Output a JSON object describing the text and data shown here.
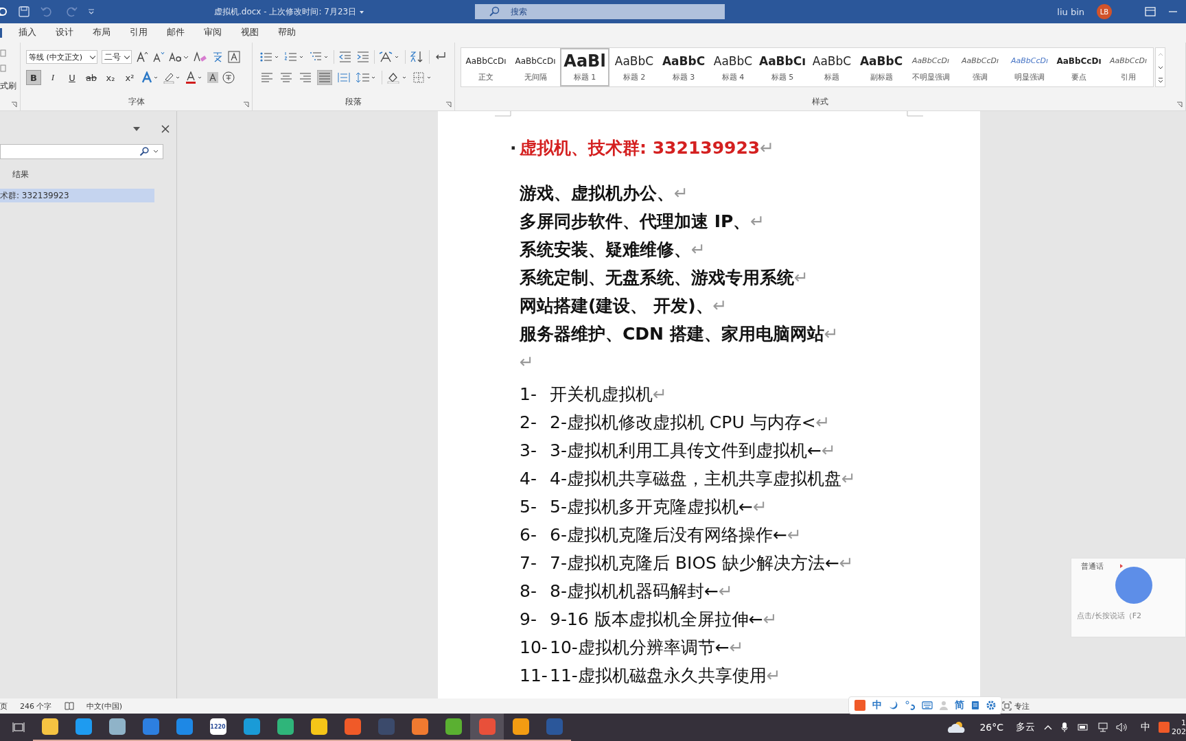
{
  "window": {
    "title": "虚拟机.docx - 上次修改时间: 7月23日",
    "search": {
      "placeholder": "搜索"
    },
    "user": {
      "name": "liu bin",
      "initials": "LB"
    }
  },
  "ribbon_tabs": [
    {
      "label": "插入",
      "selected": false
    },
    {
      "label": "设计",
      "selected": false
    },
    {
      "label": "布局",
      "selected": false
    },
    {
      "label": "引用",
      "selected": false
    },
    {
      "label": "邮件",
      "selected": false
    },
    {
      "label": "审阅",
      "selected": false
    },
    {
      "label": "视图",
      "selected": false
    },
    {
      "label": "帮助",
      "selected": false
    }
  ],
  "clipboard": {
    "label": "式刷"
  },
  "font_group": {
    "font": "等线 (中文正文)",
    "size": "二号",
    "label": "字体",
    "format_buttons": [
      {
        "label": "B",
        "kind": "bold",
        "selected": true
      },
      {
        "label": "I",
        "kind": "italic",
        "selected": false
      },
      {
        "label": "U",
        "kind": "underline",
        "selected": false
      },
      {
        "label": "ab",
        "kind": "strike",
        "selected": false
      },
      {
        "label": "x₂",
        "kind": "plain",
        "selected": false
      },
      {
        "label": "x²",
        "kind": "plain",
        "selected": false
      }
    ]
  },
  "paragraph_group": {
    "label": "段落",
    "alignments": [
      {
        "selected": false
      },
      {
        "selected": false
      },
      {
        "selected": false
      },
      {
        "selected": true
      },
      {
        "selected": false
      }
    ]
  },
  "styles_group": {
    "label": "样式",
    "styles": [
      {
        "sample": "AaBbCcDı",
        "name": "正文",
        "kind": "body",
        "selected": false
      },
      {
        "sample": "AaBbCcDı",
        "name": "无间隔",
        "kind": "body",
        "selected": false
      },
      {
        "sample": "AaBl",
        "name": "标题 1",
        "kind": "h1",
        "selected": true
      },
      {
        "sample": "AaBbC",
        "name": "标题 2",
        "kind": "h2",
        "selected": false
      },
      {
        "sample": "AaBbC",
        "name": "标题 3",
        "kind": "h3",
        "selected": false
      },
      {
        "sample": "AaBbC",
        "name": "标题 4",
        "kind": "h2",
        "selected": false
      },
      {
        "sample": "AaBbCı",
        "name": "标题 5",
        "kind": "h3",
        "selected": false
      },
      {
        "sample": "AaBbC",
        "name": "标题",
        "kind": "h2",
        "selected": false
      },
      {
        "sample": "AaBbC",
        "name": "副标题",
        "kind": "h3",
        "selected": false
      },
      {
        "sample": "AaBbCcDı",
        "name": "不明显强调",
        "kind": "italic",
        "selected": false
      },
      {
        "sample": "AaBbCcDı",
        "name": "强调",
        "kind": "italic",
        "selected": false
      },
      {
        "sample": "AaBbCcDı",
        "name": "明显强调",
        "kind": "accent",
        "selected": false
      },
      {
        "sample": "AaBbCcDı",
        "name": "要点",
        "kind": "bold",
        "selected": false
      },
      {
        "sample": "AaBbCcDı",
        "name": "引用",
        "kind": "italic",
        "selected": false
      }
    ]
  },
  "navigation_pane": {
    "tab": "结果",
    "results": [
      {
        "text": "术群: 332139923",
        "selected": true
      }
    ]
  },
  "document": {
    "title": {
      "bullet": "·",
      "text": "虚拟机、技术群: 332139923",
      "mark": "↵"
    },
    "bold_lines": [
      {
        "text": "游戏、虚拟机办公、",
        "mark": "↵"
      },
      {
        "text": "多屏同步软件、代理加速 IP、",
        "mark": "↵"
      },
      {
        "text": "系统安装、疑难维修、",
        "mark": "↵"
      },
      {
        "text": "系统定制、无盘系统、游戏专用系统",
        "mark": "↵"
      },
      {
        "text": "网站搭建(建设、 开发)、",
        "mark": "↵"
      },
      {
        "text": "服务器维护、CDN 搭建、家用电脑网站",
        "mark": "↵"
      },
      {
        "mark": "↵"
      }
    ],
    "list": [
      {
        "number": "1-",
        "text": "开关机虚拟机",
        "mark": "↵"
      },
      {
        "number": "2-",
        "text": "2-虚拟机修改虚拟机 CPU 与内存<",
        "mark": "↵"
      },
      {
        "number": "3-",
        "text": "3-虚拟机利用工具传文件到虚拟机←",
        "mark": "↵"
      },
      {
        "number": "4-",
        "text": "4-虚拟机共享磁盘，主机共享虚拟机盘",
        "mark": "↵"
      },
      {
        "number": "5-",
        "text": "5-虚拟机多开克隆虚拟机←",
        "mark": "↵"
      },
      {
        "number": "6-",
        "text": "6-虚拟机克隆后没有网络操作←",
        "mark": "↵"
      },
      {
        "number": "7-",
        "text": "7-虚拟机克隆后 BIOS 缺少解决方法←",
        "mark": "↵"
      },
      {
        "number": "8-",
        "text": "8-虚拟机机器码解封←",
        "mark": "↵"
      },
      {
        "number": "9-",
        "text": "9-16 版本虚拟机全屏拉伸←",
        "mark": "↵"
      },
      {
        "number": "10-",
        "text": "10-虚拟机分辨率调节←",
        "mark": "↵"
      },
      {
        "number": "11-",
        "text": "11-虚拟机磁盘永久共享使用",
        "mark": "↵"
      }
    ]
  },
  "voice_popup": {
    "language": "普通话",
    "hint": "点击/长按说话（F2"
  },
  "status_bar": {
    "page": "页",
    "word_count": "246 个字",
    "language": "中文(中国)",
    "focus": "专注"
  },
  "ime_toolbar": {
    "mode": "中",
    "script": "简"
  },
  "taskbar": {
    "apps": [
      {
        "color": "#f5c342",
        "selected": false
      },
      {
        "color": "#1e9bf0",
        "selected": false
      },
      {
        "color": "#8fb3c8",
        "selected": false
      },
      {
        "color": "#2d7fe0",
        "selected": false
      },
      {
        "color": "#1e88e5",
        "selected": false
      },
      {
        "color": "#ffffff",
        "label": "1220",
        "selected": false
      },
      {
        "color": "#1a9bd7",
        "selected": false
      },
      {
        "color": "#2fb57a",
        "selected": false
      },
      {
        "color": "#f5c518",
        "selected": false
      },
      {
        "color": "#f05a28",
        "selected": false
      },
      {
        "color": "#3b4a6b",
        "selected": false
      },
      {
        "color": "#f07a30",
        "selected": false
      },
      {
        "color": "#5ab031",
        "selected": false
      },
      {
        "color": "#e8503a",
        "selected": true
      },
      {
        "color": "#f39c12",
        "selected": false
      },
      {
        "color": "#2b579a",
        "selected": false
      }
    ],
    "weather": {
      "temperature": "26°C",
      "condition": "多云"
    },
    "input_language": "中",
    "clock": {
      "time": "1",
      "date": "202"
    }
  }
}
